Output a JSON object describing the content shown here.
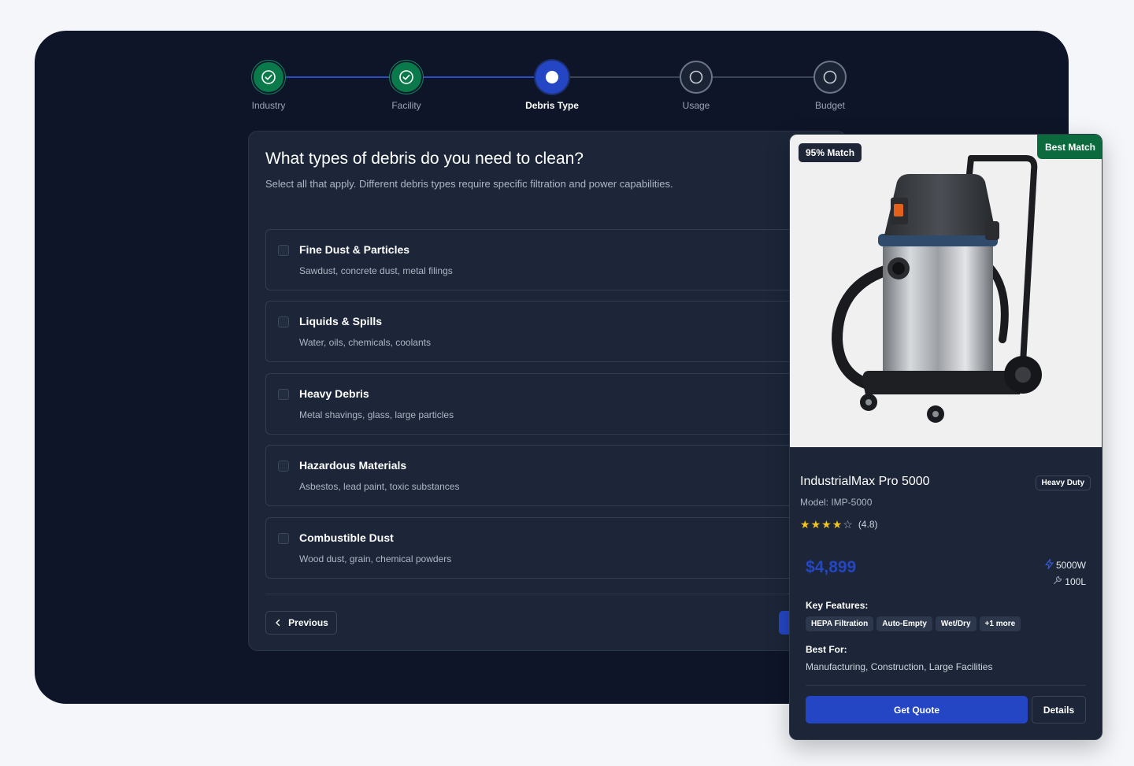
{
  "stepper": {
    "steps": [
      {
        "label": "Industry",
        "state": "done"
      },
      {
        "label": "Facility",
        "state": "done"
      },
      {
        "label": "Debris Type",
        "state": "active"
      },
      {
        "label": "Usage",
        "state": "todo"
      },
      {
        "label": "Budget",
        "state": "todo"
      }
    ]
  },
  "question": {
    "title": "What types of debris do you need to clean?",
    "subtitle": "Select all that apply. Different debris types require specific filtration and power capabilities.",
    "options": [
      {
        "title": "Fine Dust & Particles",
        "description": "Sawdust, concrete dust, metal filings",
        "checked": false
      },
      {
        "title": "Liquids & Spills",
        "description": "Water, oils, chemicals, coolants",
        "checked": false
      },
      {
        "title": "Heavy Debris",
        "description": "Metal shavings, glass, large particles",
        "checked": false
      },
      {
        "title": "Hazardous Materials",
        "description": "Asbestos, lead paint, toxic substances",
        "checked": false
      },
      {
        "title": "Combustible Dust",
        "description": "Wood dust, grain, chemical powders",
        "checked": false
      }
    ],
    "previous_label": "Previous"
  },
  "product": {
    "match_badge": "95% Match",
    "best_badge": "Best Match",
    "name": "IndustrialMax Pro 5000",
    "duty_badge": "Heavy Duty",
    "model": "Model: IMP-5000",
    "rating_value": 4.8,
    "rating_text": "(4.8)",
    "price": "$4,899",
    "power": "5000W",
    "volume": "100L",
    "features_label": "Key Features:",
    "features": [
      "HEPA Filtration",
      "Auto-Empty",
      "Wet/Dry",
      "+1 more"
    ],
    "best_for_label": "Best For:",
    "best_for": "Manufacturing, Construction, Large Facilities",
    "quote_label": "Get Quote",
    "details_label": "Details"
  },
  "icons": {
    "step_done": "check-circle-icon",
    "step_todo": "circle-icon",
    "previous": "chevron-left-icon",
    "power": "lightning-icon",
    "volume": "wrench-icon"
  },
  "colors": {
    "accent": "#2446c4",
    "success": "#0b7a4b",
    "star": "#f5c518",
    "shell_bg": "#0e1528",
    "card_bg": "#1c2638"
  }
}
